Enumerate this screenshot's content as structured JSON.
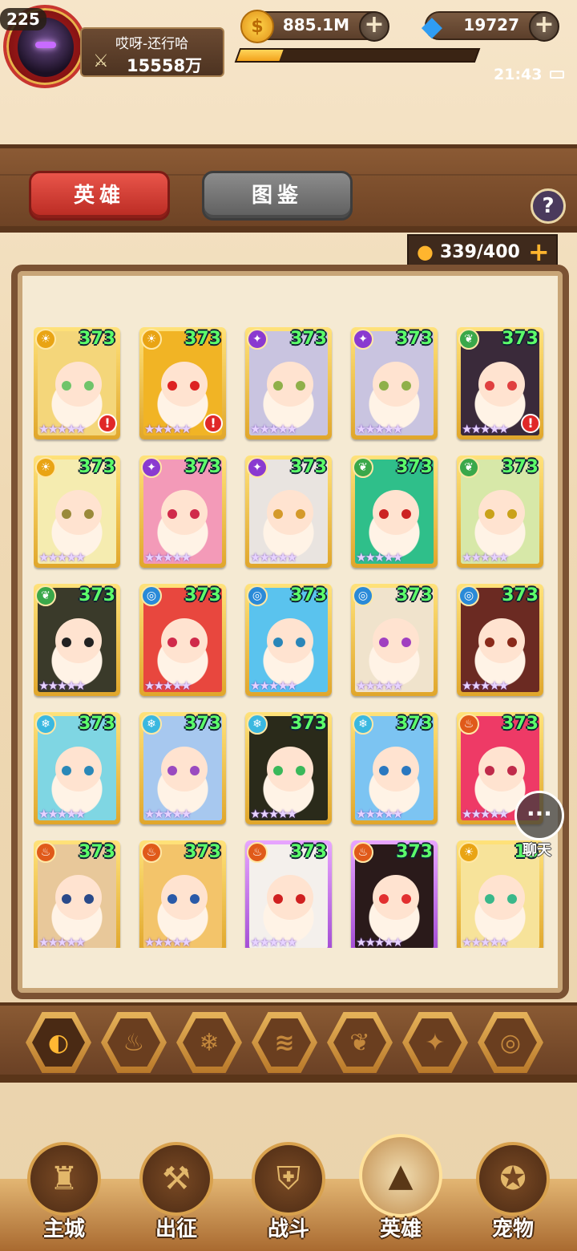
{
  "player": {
    "level": "225",
    "name": "哎呀-还行哈",
    "power": "15558万",
    "exp_progress": 0.18
  },
  "currency": {
    "gold": "885.1M",
    "gems": "19727"
  },
  "status": {
    "time": "21:43"
  },
  "tabs": {
    "heroes": "英雄",
    "codex": "图鉴",
    "help": "?"
  },
  "capacity": "339/400",
  "chat": {
    "label": "聊天"
  },
  "colors": {
    "accent_red": "#c93a30",
    "level_green": "#5cff6a",
    "gold": "#f2a21c"
  },
  "heroes": [
    {
      "level": "373",
      "element": "light",
      "alert": true,
      "frame": "gold",
      "hair": "#f4d67a",
      "eye": "#6fc46a"
    },
    {
      "level": "373",
      "element": "light",
      "alert": true,
      "frame": "gold",
      "hair": "#f1b425",
      "eye": "#d22"
    },
    {
      "level": "373",
      "element": "dark",
      "alert": false,
      "frame": "gold",
      "hair": "#c9c4e0",
      "eye": "#8fb04a"
    },
    {
      "level": "373",
      "element": "dark",
      "alert": false,
      "frame": "gold",
      "hair": "#c9c4e0",
      "eye": "#8fb04a"
    },
    {
      "level": "373",
      "element": "nature",
      "alert": true,
      "frame": "gold",
      "hair": "#3a2a3a",
      "eye": "#e04040"
    },
    {
      "level": "373",
      "element": "light",
      "alert": false,
      "frame": "gold",
      "hair": "#f5ecb0",
      "eye": "#9a8a3a"
    },
    {
      "level": "373",
      "element": "dark",
      "alert": false,
      "frame": "gold",
      "hair": "#f39ab8",
      "eye": "#d02a4a"
    },
    {
      "level": "373",
      "element": "dark",
      "alert": false,
      "frame": "gold",
      "hair": "#e9e4e0",
      "eye": "#d49a2a"
    },
    {
      "level": "373",
      "element": "nature",
      "alert": false,
      "frame": "gold",
      "hair": "#2fbf8a",
      "eye": "#c22"
    },
    {
      "level": "373",
      "element": "nature",
      "alert": false,
      "frame": "gold",
      "hair": "#d7e8a8",
      "eye": "#c9a21a"
    },
    {
      "level": "373",
      "element": "nature",
      "alert": false,
      "frame": "gold",
      "hair": "#3a3a2a",
      "eye": "#222"
    },
    {
      "level": "373",
      "element": "water",
      "alert": false,
      "frame": "gold",
      "hair": "#e8473e",
      "eye": "#d02a4a"
    },
    {
      "level": "373",
      "element": "water",
      "alert": false,
      "frame": "gold",
      "hair": "#5ac3ee",
      "eye": "#2a86b8"
    },
    {
      "level": "373",
      "element": "water",
      "alert": false,
      "frame": "gold",
      "hair": "#f0e3cc",
      "eye": "#a040c0"
    },
    {
      "level": "373",
      "element": "water",
      "alert": false,
      "frame": "gold",
      "hair": "#6b2a22",
      "eye": "#8a2a1a"
    },
    {
      "level": "373",
      "element": "ice",
      "alert": false,
      "frame": "gold",
      "hair": "#7fd6e3",
      "eye": "#2a88b8"
    },
    {
      "level": "373",
      "element": "ice",
      "alert": false,
      "frame": "gold",
      "hair": "#a7c8ef",
      "eye": "#9a4ac0"
    },
    {
      "level": "373",
      "element": "ice",
      "alert": false,
      "frame": "gold",
      "hair": "#2a2a1a",
      "eye": "#3ab85a"
    },
    {
      "level": "373",
      "element": "ice",
      "alert": false,
      "frame": "gold",
      "hair": "#7cc4f2",
      "eye": "#2a78c0"
    },
    {
      "level": "373",
      "element": "fire",
      "alert": false,
      "frame": "gold",
      "hair": "#ee3a66",
      "eye": "#c02a4a"
    },
    {
      "level": "373",
      "element": "fire",
      "alert": false,
      "frame": "gold",
      "hair": "#e8c89a",
      "eye": "#2a4a8a"
    },
    {
      "level": "373",
      "element": "fire",
      "alert": false,
      "frame": "gold",
      "hair": "#f3c46a",
      "eye": "#2a5aa8"
    },
    {
      "level": "373",
      "element": "fire",
      "alert": false,
      "frame": "purple",
      "hair": "#f4f0ec",
      "eye": "#d02020"
    },
    {
      "level": "373",
      "element": "fire",
      "alert": false,
      "frame": "purple",
      "hair": "#2a1a1a",
      "eye": "#e23030"
    },
    {
      "level": "15",
      "element": "light",
      "alert": false,
      "frame": "gold",
      "hair": "#f7e39a",
      "eye": "#3ab88a"
    }
  ],
  "filters": [
    "all-filter",
    "fire-filter",
    "ice-filter",
    "wind-filter",
    "nature-filter",
    "dark-filter",
    "water-filter"
  ],
  "nav": [
    {
      "label": "主城",
      "icon": "castle-icon"
    },
    {
      "label": "出征",
      "icon": "crossed-swords-icon"
    },
    {
      "label": "战斗",
      "icon": "battle-shield-icon"
    },
    {
      "label": "英雄",
      "icon": "hooded-hero-icon"
    },
    {
      "label": "宠物",
      "icon": "dragon-pet-icon"
    }
  ]
}
